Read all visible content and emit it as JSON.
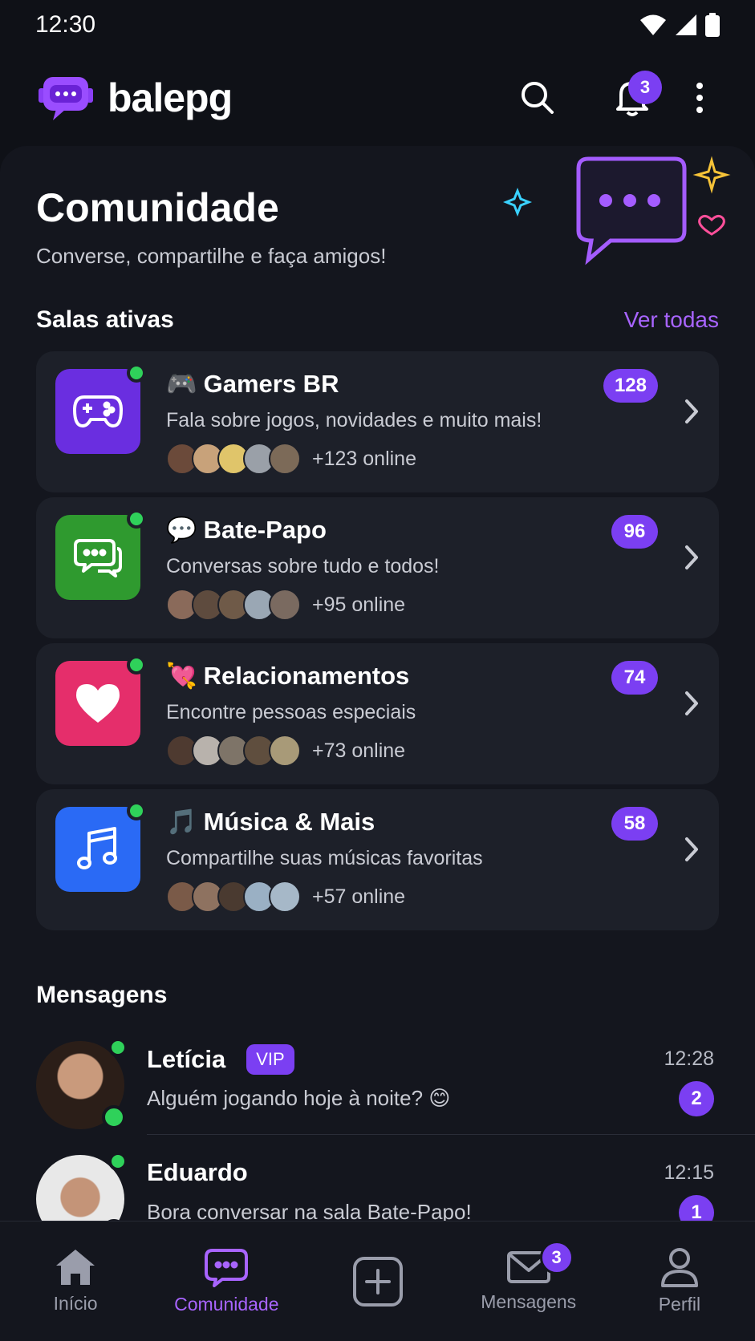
{
  "status_bar": {
    "time": "12:30"
  },
  "header": {
    "app_name": "balepg",
    "notifications_count": "3"
  },
  "hero": {
    "title": "Comunidade",
    "subtitle": "Converse, compartilhe e faça amigos!"
  },
  "rooms_section": {
    "title": "Salas ativas",
    "see_all": "Ver todas"
  },
  "rooms": [
    {
      "emoji": "🎮",
      "name": "Gamers BR",
      "description": "Fala sobre jogos, novidades e muito mais!",
      "online": "+123 online",
      "count": "128",
      "icon": "gamepad-icon",
      "color": "#6a2ee0"
    },
    {
      "emoji": "💬",
      "name": "Bate-Papo",
      "description": "Conversas sobre tudo e todos!",
      "online": "+95 online",
      "count": "96",
      "icon": "chat-bubbles-icon",
      "color": "#2f9a2f"
    },
    {
      "emoji": "💘",
      "name": "Relacionamentos",
      "description": "Encontre pessoas especiais",
      "online": "+73 online",
      "count": "74",
      "icon": "heart-icon",
      "color": "#e52e6b"
    },
    {
      "emoji": "🎵",
      "name": "Música & Mais",
      "description": "Compartilhe suas músicas favoritas",
      "online": "+57 online",
      "count": "58",
      "icon": "music-note-icon",
      "color": "#2a6af5"
    }
  ],
  "messages_section": {
    "title": "Mensagens"
  },
  "messages": [
    {
      "name": "Letícia",
      "badge": "VIP",
      "text": "Alguém jogando hoje à noite? 😊",
      "time": "12:28",
      "unread": "2"
    },
    {
      "name": "Eduardo",
      "text": "Bora conversar na sala Bate-Papo!",
      "time": "12:15",
      "unread": "1"
    }
  ],
  "bottom_nav": {
    "items": [
      {
        "label": "Início",
        "icon": "home-icon"
      },
      {
        "label": "Comunidade",
        "icon": "community-chat-icon"
      },
      {
        "label": "",
        "icon": "add-icon"
      },
      {
        "label": "Mensagens",
        "icon": "mail-icon"
      },
      {
        "label": "Perfil",
        "icon": "profile-icon"
      }
    ],
    "messages_badge": "3"
  },
  "colors": {
    "accent": "#7b3ff2",
    "accent_text": "#a864ff",
    "online": "#2fd15a",
    "background": "#0f1117",
    "card": "#1d2029"
  }
}
